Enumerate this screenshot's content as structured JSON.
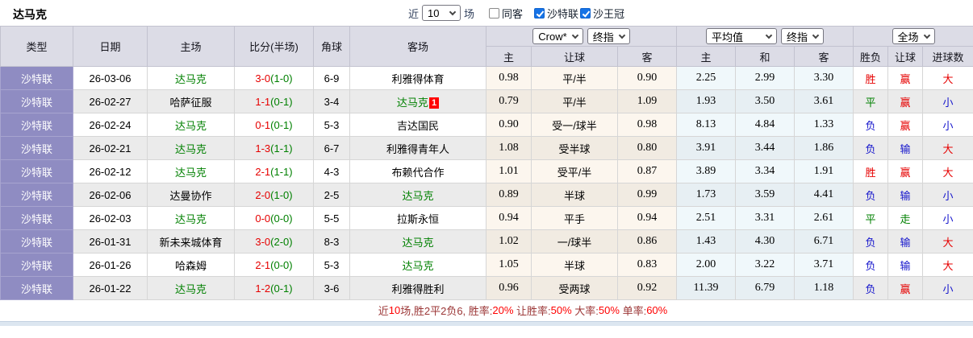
{
  "topbar": {
    "title": "达马克",
    "near_label": "近",
    "count_select": "10",
    "matches_label": "场",
    "checkboxes": [
      {
        "label": "同客",
        "checked": false
      },
      {
        "label": "沙特联",
        "checked": true
      },
      {
        "label": "沙王冠",
        "checked": true
      }
    ]
  },
  "header": {
    "col_type": "类型",
    "col_date": "日期",
    "col_home": "主场",
    "col_score": "比分(半场)",
    "col_corner": "角球",
    "col_away": "客场",
    "dropdown_bookmaker": "Crow*",
    "dropdown_final1": "终指",
    "dropdown_average": "平均值",
    "dropdown_final2": "终指",
    "dropdown_fulltime": "全场",
    "sub": [
      "主",
      "让球",
      "客",
      "主",
      "和",
      "客",
      "胜负",
      "让球",
      "进球数"
    ]
  },
  "colors": {
    "league_column": "#8f8cc2",
    "header_bg": "#dcdce6",
    "win_red": "#e60000",
    "draw_green": "#008000",
    "lose_blue": "#1515cc",
    "odds_bg": "#fcf6ee",
    "avg_bg": "#f0f8fb"
  },
  "rows": [
    {
      "league": "沙特联",
      "date": "26-03-06",
      "home": "达马克",
      "home_self": true,
      "score": "3-0",
      "half": "(1-0)",
      "corner": "6-9",
      "away": "利雅得体育",
      "away_self": false,
      "away_badge": "",
      "odds": [
        "0.98",
        "平/半",
        "0.90"
      ],
      "avg": [
        "2.25",
        "2.99",
        "3.30"
      ],
      "result": {
        "text": "胜",
        "color": "red"
      },
      "handicap": {
        "text": "赢",
        "color": "red"
      },
      "goals": {
        "text": "大",
        "color": "red"
      }
    },
    {
      "league": "沙特联",
      "date": "26-02-27",
      "home": "哈萨征服",
      "home_self": false,
      "score": "1-1",
      "half": "(0-1)",
      "corner": "3-4",
      "away": "达马克",
      "away_self": true,
      "away_badge": "1",
      "odds": [
        "0.79",
        "平/半",
        "1.09"
      ],
      "avg": [
        "1.93",
        "3.50",
        "3.61"
      ],
      "result": {
        "text": "平",
        "color": "green"
      },
      "handicap": {
        "text": "赢",
        "color": "red"
      },
      "goals": {
        "text": "小",
        "color": "blue"
      }
    },
    {
      "league": "沙特联",
      "date": "26-02-24",
      "home": "达马克",
      "home_self": true,
      "score": "0-1",
      "half": "(0-1)",
      "corner": "5-3",
      "away": "吉达国民",
      "away_self": false,
      "away_badge": "",
      "odds": [
        "0.90",
        "受一/球半",
        "0.98"
      ],
      "avg": [
        "8.13",
        "4.84",
        "1.33"
      ],
      "result": {
        "text": "负",
        "color": "blue"
      },
      "handicap": {
        "text": "赢",
        "color": "red"
      },
      "goals": {
        "text": "小",
        "color": "blue"
      }
    },
    {
      "league": "沙特联",
      "date": "26-02-21",
      "home": "达马克",
      "home_self": true,
      "score": "1-3",
      "half": "(1-1)",
      "corner": "6-7",
      "away": "利雅得青年人",
      "away_self": false,
      "away_badge": "",
      "odds": [
        "1.08",
        "受半球",
        "0.80"
      ],
      "avg": [
        "3.91",
        "3.44",
        "1.86"
      ],
      "result": {
        "text": "负",
        "color": "blue"
      },
      "handicap": {
        "text": "输",
        "color": "blue"
      },
      "goals": {
        "text": "大",
        "color": "red"
      }
    },
    {
      "league": "沙特联",
      "date": "26-02-12",
      "home": "达马克",
      "home_self": true,
      "score": "2-1",
      "half": "(1-1)",
      "corner": "4-3",
      "away": "布赖代合作",
      "away_self": false,
      "away_badge": "",
      "odds": [
        "1.01",
        "受平/半",
        "0.87"
      ],
      "avg": [
        "3.89",
        "3.34",
        "1.91"
      ],
      "result": {
        "text": "胜",
        "color": "red"
      },
      "handicap": {
        "text": "赢",
        "color": "red"
      },
      "goals": {
        "text": "大",
        "color": "red"
      }
    },
    {
      "league": "沙特联",
      "date": "26-02-06",
      "home": "达曼协作",
      "home_self": false,
      "score": "2-0",
      "half": "(1-0)",
      "corner": "2-5",
      "away": "达马克",
      "away_self": true,
      "away_badge": "",
      "odds": [
        "0.89",
        "半球",
        "0.99"
      ],
      "avg": [
        "1.73",
        "3.59",
        "4.41"
      ],
      "result": {
        "text": "负",
        "color": "blue"
      },
      "handicap": {
        "text": "输",
        "color": "blue"
      },
      "goals": {
        "text": "小",
        "color": "blue"
      }
    },
    {
      "league": "沙特联",
      "date": "26-02-03",
      "home": "达马克",
      "home_self": true,
      "score": "0-0",
      "half": "(0-0)",
      "corner": "5-5",
      "away": "拉斯永恒",
      "away_self": false,
      "away_badge": "",
      "odds": [
        "0.94",
        "平手",
        "0.94"
      ],
      "avg": [
        "2.51",
        "3.31",
        "2.61"
      ],
      "result": {
        "text": "平",
        "color": "green"
      },
      "handicap": {
        "text": "走",
        "color": "green"
      },
      "goals": {
        "text": "小",
        "color": "blue"
      }
    },
    {
      "league": "沙特联",
      "date": "26-01-31",
      "home": "新未来城体育",
      "home_self": false,
      "score": "3-0",
      "half": "(2-0)",
      "corner": "8-3",
      "away": "达马克",
      "away_self": true,
      "away_badge": "",
      "odds": [
        "1.02",
        "一/球半",
        "0.86"
      ],
      "avg": [
        "1.43",
        "4.30",
        "6.71"
      ],
      "result": {
        "text": "负",
        "color": "blue"
      },
      "handicap": {
        "text": "输",
        "color": "blue"
      },
      "goals": {
        "text": "大",
        "color": "red"
      }
    },
    {
      "league": "沙特联",
      "date": "26-01-26",
      "home": "哈森姆",
      "home_self": false,
      "score": "2-1",
      "half": "(0-0)",
      "corner": "5-3",
      "away": "达马克",
      "away_self": true,
      "away_badge": "",
      "odds": [
        "1.05",
        "半球",
        "0.83"
      ],
      "avg": [
        "2.00",
        "3.22",
        "3.71"
      ],
      "result": {
        "text": "负",
        "color": "blue"
      },
      "handicap": {
        "text": "输",
        "color": "blue"
      },
      "goals": {
        "text": "大",
        "color": "red"
      }
    },
    {
      "league": "沙特联",
      "date": "26-01-22",
      "home": "达马克",
      "home_self": true,
      "score": "1-2",
      "half": "(0-1)",
      "corner": "3-6",
      "away": "利雅得胜利",
      "away_self": false,
      "away_badge": "",
      "odds": [
        "0.96",
        "受两球",
        "0.92"
      ],
      "avg": [
        "11.39",
        "6.79",
        "1.18"
      ],
      "result": {
        "text": "负",
        "color": "blue"
      },
      "handicap": {
        "text": "赢",
        "color": "red"
      },
      "goals": {
        "text": "小",
        "color": "blue"
      }
    }
  ],
  "summary": {
    "segments": [
      {
        "text": "近",
        "color": "dark"
      },
      {
        "text": "10",
        "color": "red"
      },
      {
        "text": "场,胜2平2负6, 胜率:",
        "color": "dark"
      },
      {
        "text": "20%",
        "color": "red"
      },
      {
        "text": " 让胜率:",
        "color": "dark"
      },
      {
        "text": "50%",
        "color": "red"
      },
      {
        "text": " 大率:",
        "color": "dark"
      },
      {
        "text": "50%",
        "color": "red"
      },
      {
        "text": " 单率:",
        "color": "dark"
      },
      {
        "text": "60%",
        "color": "red"
      }
    ]
  }
}
